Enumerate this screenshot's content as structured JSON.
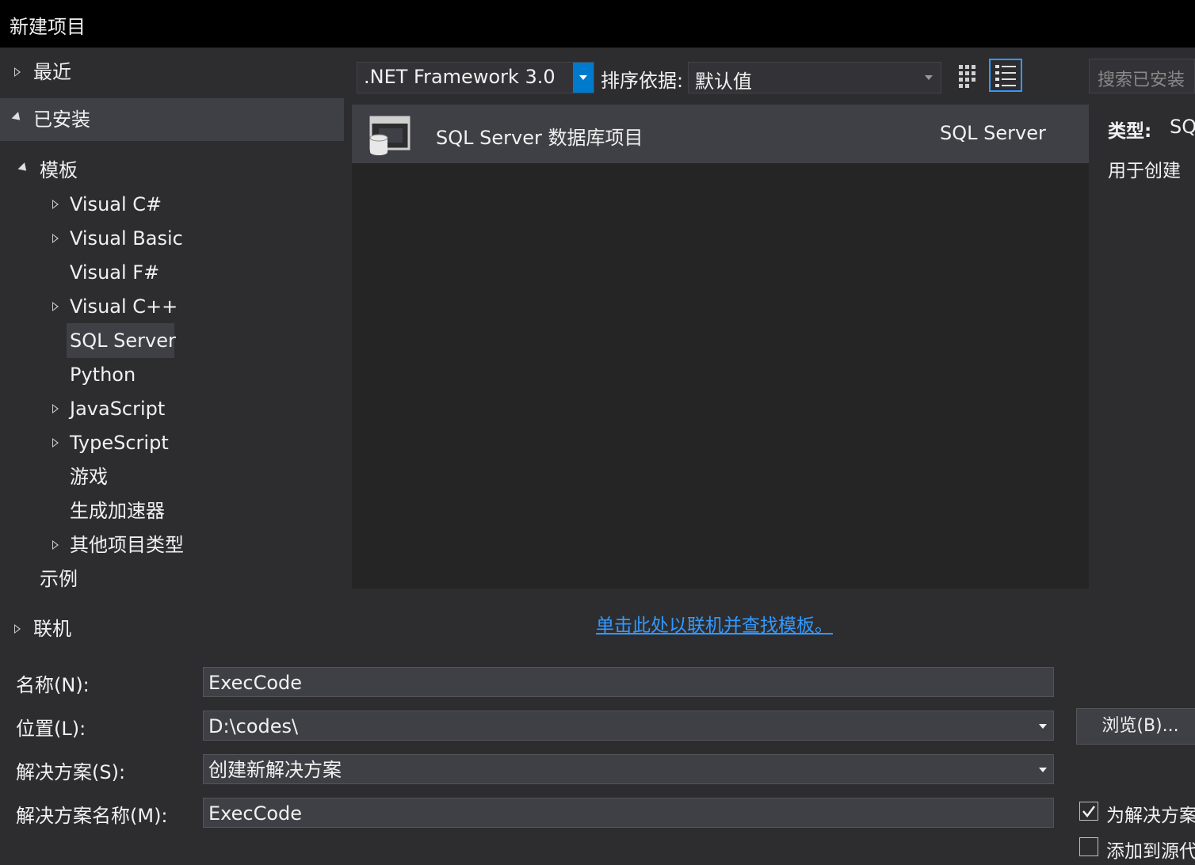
{
  "window": {
    "title": "新建项目"
  },
  "tree": {
    "recent": "最近",
    "installed": "已安装",
    "templates": "模板",
    "children": [
      "Visual C#",
      "Visual Basic",
      "Visual F#",
      "Visual C++",
      "SQL Server",
      "Python",
      "JavaScript",
      "TypeScript",
      "游戏",
      "生成加速器",
      "其他项目类型"
    ],
    "samples": "示例",
    "online": "联机"
  },
  "toolbar": {
    "framework": ".NET Framework 3.0",
    "sort_label": "排序依据:",
    "sort_value": "默认值",
    "search_placeholder": "搜索已安装"
  },
  "templates": [
    {
      "name": "SQL Server 数据库项目",
      "type": "SQL Server"
    }
  ],
  "details": {
    "type_label": "类型:",
    "type_value": "SQ",
    "description": "用于创建"
  },
  "online_link": "单击此处以联机并查找模板。",
  "form": {
    "name_label": "名称(N):",
    "name_value": "ExecCode",
    "location_label": "位置(L):",
    "location_value": "D:\\codes\\",
    "solution_label": "解决方案(S):",
    "solution_value": "创建新解决方案",
    "solution_name_label": "解决方案名称(M):",
    "solution_name_value": "ExecCode",
    "browse_label": "浏览(B)...",
    "create_dir_label": "为解决方案",
    "create_dir_checked": true,
    "source_control_label": "添加到源代",
    "source_control_checked": false
  }
}
